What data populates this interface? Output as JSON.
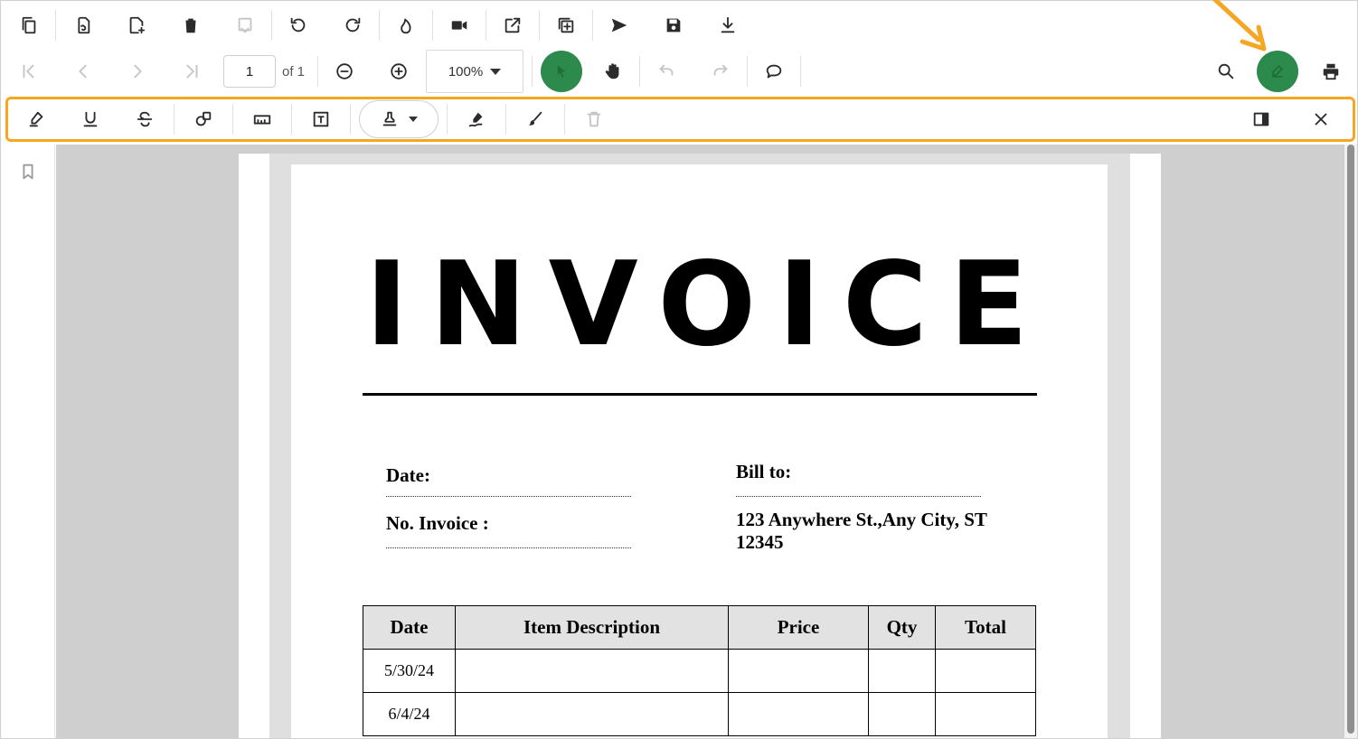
{
  "toolbar": {
    "current_page": "1",
    "page_count_label": "of 1",
    "zoom_value": "100%"
  },
  "document": {
    "title": "INVOICE",
    "date_label": "Date:",
    "invoice_no_label": "No. Invoice :",
    "bill_to_label": "Bill to:",
    "address_line1": "123 Anywhere St.,Any City, ST",
    "address_line2": "12345",
    "table": {
      "headers": [
        "Date",
        "Item Description",
        "Price",
        "Qty",
        "Total"
      ],
      "rows": [
        [
          "5/30/24",
          "",
          "",
          "",
          ""
        ],
        [
          "6/4/24",
          "",
          "",
          "",
          ""
        ]
      ]
    }
  },
  "colors": {
    "accent_green": "#2c8a4c",
    "highlight_orange": "#f5a623"
  }
}
